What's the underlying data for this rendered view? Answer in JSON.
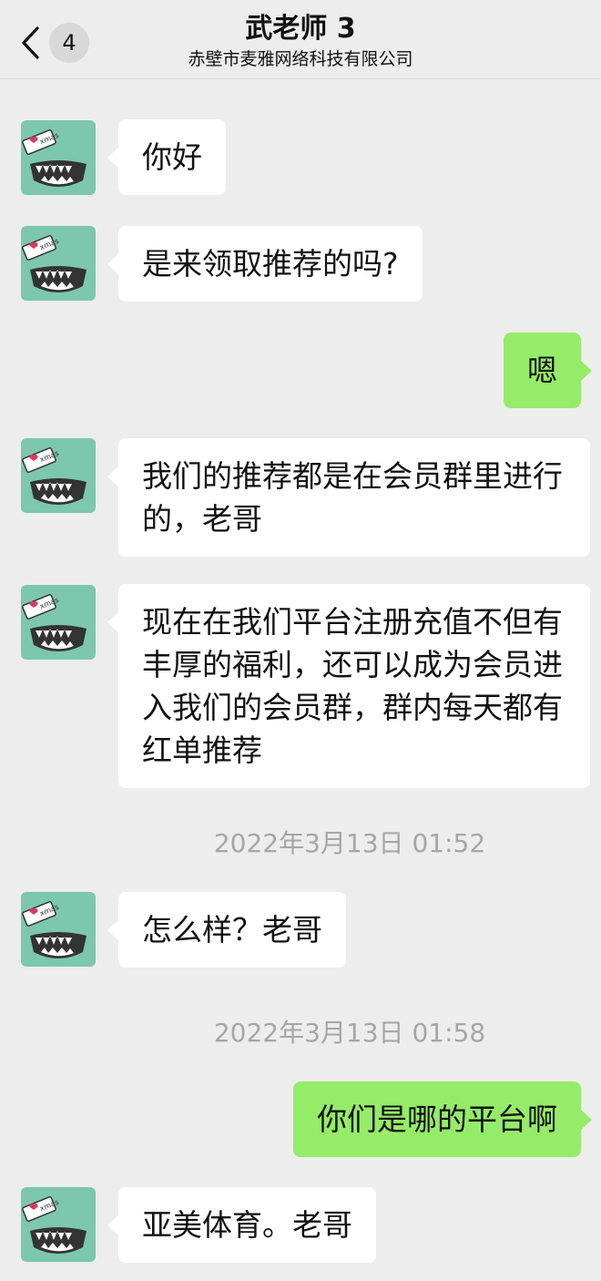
{
  "header": {
    "back_badge": "4",
    "title": "武老师 3",
    "subtitle": "赤壁市麦雅网络科技有限公司"
  },
  "avatar": {
    "card_text": "xmas",
    "icon": "monster-avatar-icon"
  },
  "messages": [
    {
      "side": "in",
      "text": "你好"
    },
    {
      "side": "in",
      "text": "是来领取推荐的吗?"
    },
    {
      "side": "out",
      "text": "嗯"
    },
    {
      "side": "in",
      "text": "我们的推荐都是在会员群里进行的，老哥"
    },
    {
      "side": "in",
      "text": "现在在我们平台注册充值不但有丰厚的福利，还可以成为会员进入我们的会员群，群内每天都有红单推荐"
    },
    {
      "side": "in",
      "text": "怎么样？老哥"
    },
    {
      "side": "out",
      "text": "你们是哪的平台啊"
    },
    {
      "side": "in",
      "text": "亚美体育。老哥"
    }
  ],
  "timestamps": [
    "2022年3月13日 01:52",
    "2022年3月13日 01:58"
  ],
  "colors": {
    "background": "#ededed",
    "incoming_bubble": "#ffffff",
    "outgoing_bubble": "#95ec69",
    "avatar": "#7cc7ae",
    "timestamp_text": "#a6a6a6"
  }
}
